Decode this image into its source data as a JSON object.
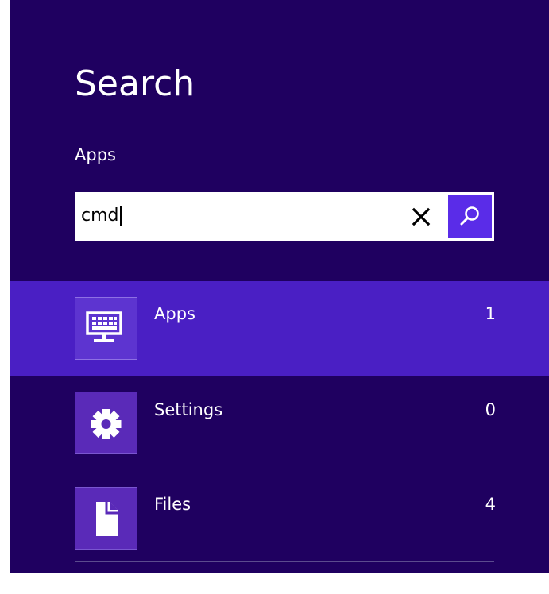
{
  "header": {
    "title": "Search",
    "scope_label": "Apps"
  },
  "search": {
    "query": "cmd",
    "clear_icon": "close-icon",
    "search_icon": "magnifier-icon"
  },
  "results": [
    {
      "label": "Apps",
      "count": "1",
      "icon": "apps-keyboard-icon",
      "selected": true
    },
    {
      "label": "Settings",
      "count": "0",
      "icon": "gear-icon",
      "selected": false
    },
    {
      "label": "Files",
      "count": "4",
      "icon": "file-icon",
      "selected": false
    }
  ],
  "colors": {
    "background": "#1f0060",
    "selected_row": "#4a1fc4",
    "tile": "#5a2ab8",
    "search_button": "#5a2ce8"
  }
}
